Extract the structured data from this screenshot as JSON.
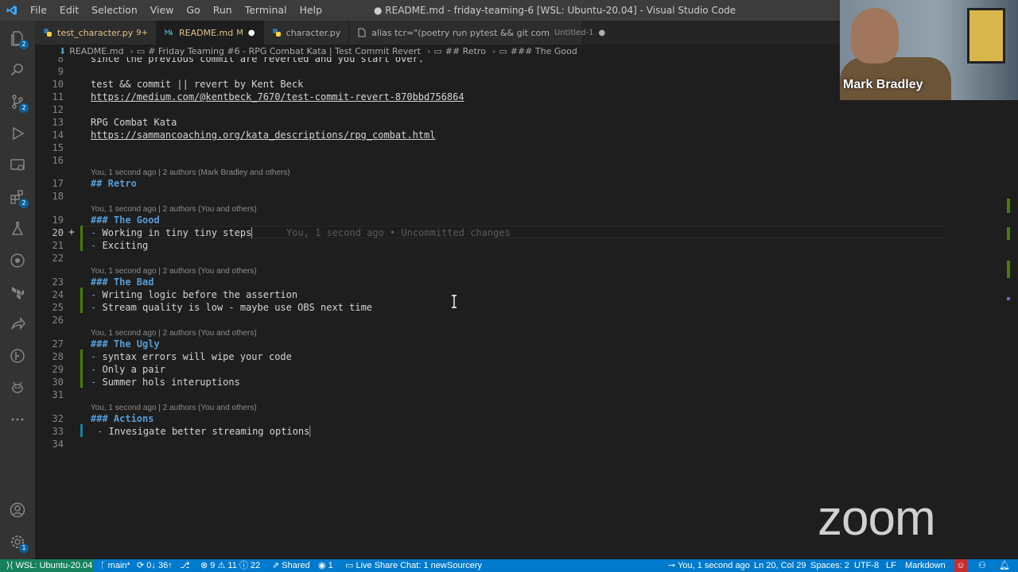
{
  "window": {
    "title": "● README.md - friday-teaming-6 [WSL: Ubuntu-20.04] - Visual Studio Code"
  },
  "menu": [
    "File",
    "Edit",
    "Selection",
    "View",
    "Go",
    "Run",
    "Terminal",
    "Help"
  ],
  "activity": {
    "explorer_badge": "2",
    "scm_badge": "2",
    "extensions_badge": "2",
    "settings_badge": "1"
  },
  "tabs": [
    {
      "label": "test_character.py",
      "status": "9+",
      "icon": "python-icon"
    },
    {
      "label": "README.md",
      "status": "M",
      "icon": "markdown-icon"
    },
    {
      "label": "character.py",
      "status": "",
      "icon": "python-icon"
    },
    {
      "label": "alias tcr=\"(poetry run pytest && git com",
      "sub": "Untitled-1",
      "icon": "file-icon"
    }
  ],
  "breadcrumb": [
    "README.md",
    "# Friday Teaming #6 - RPG Combat Kata | Test Commit Revert",
    "## Retro",
    "### The Good"
  ],
  "editor": {
    "lines": [
      {
        "n": "8",
        "text": "since the previous commit are reverted and you start over."
      },
      {
        "n": "9",
        "text": ""
      },
      {
        "n": "10",
        "text": "test && commit || revert by Kent Beck"
      },
      {
        "n": "11",
        "text": "https://medium.com/@kentbeck_7670/test-commit-revert-870bbd756864"
      },
      {
        "n": "12",
        "text": ""
      },
      {
        "n": "13",
        "text": "RPG Combat Kata"
      },
      {
        "n": "14",
        "text": "https://sammancoaching.org/kata_descriptions/rpg_combat.html"
      },
      {
        "n": "15",
        "text": ""
      },
      {
        "n": "16",
        "text": ""
      },
      {
        "n": "17",
        "text": "## Retro"
      },
      {
        "n": "18",
        "text": ""
      },
      {
        "n": "19",
        "text": "### The Good"
      },
      {
        "n": "20",
        "text": "Working in tiny tiny steps"
      },
      {
        "n": "21",
        "text": "Exciting"
      },
      {
        "n": "22",
        "text": ""
      },
      {
        "n": "23",
        "text": "### The Bad"
      },
      {
        "n": "24",
        "text": "Writing logic before the assertion"
      },
      {
        "n": "25",
        "text": "Stream quality is low - maybe use OBS next time"
      },
      {
        "n": "26",
        "text": ""
      },
      {
        "n": "27",
        "text": "### The Ugly"
      },
      {
        "n": "28",
        "text": "syntax errors will wipe your code"
      },
      {
        "n": "29",
        "text": "Only a pair"
      },
      {
        "n": "30",
        "text": "Summer hols interuptions"
      },
      {
        "n": "31",
        "text": ""
      },
      {
        "n": "32",
        "text": "### Actions"
      },
      {
        "n": "33",
        "text": "Invesigate better streaming options"
      },
      {
        "n": "34",
        "text": ""
      }
    ],
    "lens": [
      "You, 1 second ago | 2 authors (Mark Bradley and others)",
      "You, 1 second ago | 2 authors (You and others)",
      "You, 1 second ago | 2 authors (You and others)",
      "You, 1 second ago | 2 authors (You and others)",
      "You, 1 second ago | 2 authors (You and others)"
    ],
    "inline_blame": "You, 1 second ago • Uncommitted changes",
    "list_dash": "-"
  },
  "video": {
    "name": "Mark Bradley"
  },
  "zoom_logo": "zoom",
  "statusbar": {
    "remote": "WSL: Ubuntu-20.04",
    "branch": "main*",
    "sync": "0↓ 36↑",
    "errors": "9",
    "warnings": "11",
    "info": "22",
    "shared": "Shared",
    "ports": "1",
    "chat": "Live Share Chat: 1 new",
    "sourcery": "Sourcery",
    "blame": "You, 1 second ago",
    "position": "Ln 20, Col 29",
    "spaces": "Spaces: 2",
    "encoding": "UTF-8",
    "eol": "LF",
    "language": "Markdown"
  },
  "colors": {
    "statusbar": "#007acc",
    "remote": "#16825d",
    "heading": "#569cd6",
    "added": "#487e02",
    "modified_tab": "#e2c08d"
  }
}
